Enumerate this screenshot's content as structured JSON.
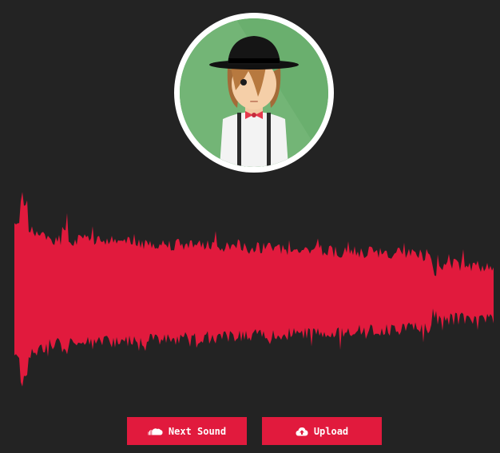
{
  "player": {
    "accent_color": "#e11a3d",
    "background_color": "#232323",
    "avatar": {
      "icon": "hipster-avatar-icon",
      "background_color": "#6aaf6e",
      "ring_color": "#ffffff"
    },
    "waveform": {
      "color": "#e11a3d",
      "icon": "audio-waveform"
    },
    "buttons": {
      "next": {
        "label": "Next Sound",
        "icon": "soundcloud-icon"
      },
      "upload": {
        "label": "Upload",
        "icon": "cloud-upload-icon"
      }
    }
  }
}
